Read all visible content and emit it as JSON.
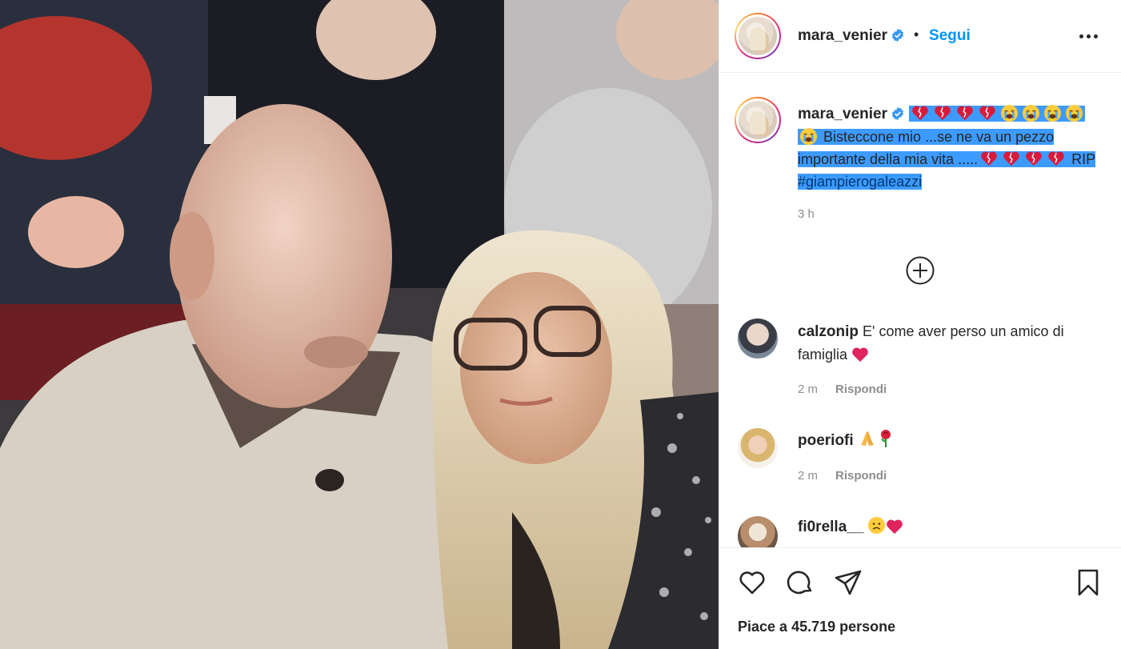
{
  "post": {
    "author": {
      "username": "mara_venier",
      "separator": "•",
      "follow_label": "Segui",
      "verified": true,
      "verified_color": "#3897f0"
    },
    "caption": {
      "username": "mara_venier",
      "text_line": "Bisteccone mio ...se ne va un pezzo importante della mia vita .....",
      "rip": "RIP",
      "hashtag": "#giampierogaleazzi",
      "time": "3 h",
      "highlight_color": "#3d9bff",
      "leading_emojis": [
        "broken-heart",
        "broken-heart",
        "broken-heart",
        "broken-heart",
        "sob",
        "sob",
        "sob",
        "sob",
        "sob"
      ],
      "trailing_emojis": [
        "broken-heart",
        "broken-heart",
        "broken-heart",
        "broken-heart"
      ]
    },
    "load_more_icon": "plus-circle-icon",
    "comments": [
      {
        "username": "calzonip",
        "text": "E' come aver perso un amico di famiglia",
        "emojis": [
          "red-heart"
        ],
        "time": "2 m",
        "reply_label": "Rispondi"
      },
      {
        "username": "poeriofi",
        "text": "",
        "emojis": [
          "folded-hands",
          "rose"
        ],
        "time": "2 m",
        "reply_label": "Rispondi"
      },
      {
        "username": "fi0rella__",
        "text": "",
        "emojis": [
          "sad-face",
          "red-heart"
        ],
        "time": "",
        "reply_label": ""
      }
    ],
    "actions": {
      "icons": [
        "heart-icon",
        "comment-icon",
        "share-icon",
        "save-icon"
      ],
      "likes_prefix": "Piace a",
      "likes_count": "45.719",
      "likes_suffix": "persone"
    },
    "colors": {
      "link_blue": "#0095f6",
      "text": "#262626",
      "muted": "#8e8e8e",
      "heart_red": "#e0245e"
    }
  }
}
